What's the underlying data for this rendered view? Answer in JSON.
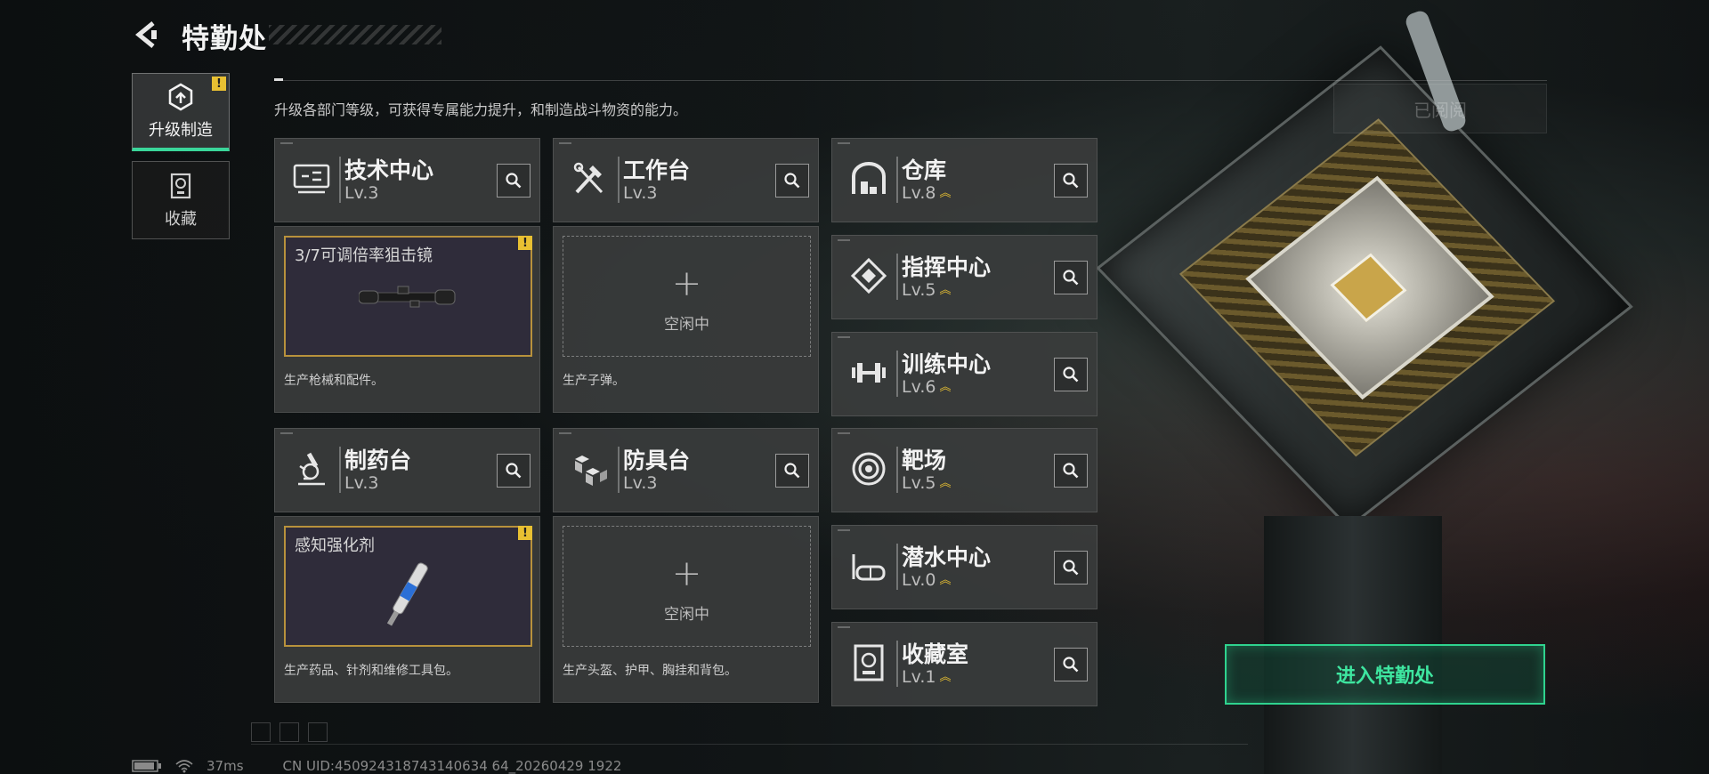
{
  "header": {
    "title": "特勤处",
    "subtitle": "升级各部门等级，可获得专属能力提升，和制造战斗物资的能力。",
    "read_label": "已阅阅"
  },
  "sidebar": {
    "tabs": [
      {
        "label": "升级制造",
        "icon": "upgrade-make-icon",
        "active": true,
        "alert": "!"
      },
      {
        "label": "收藏",
        "icon": "collection-icon",
        "active": false
      }
    ]
  },
  "departments": {
    "tech_center": {
      "name": "技术中心",
      "level": "Lv.3",
      "icon": "monitor-icon"
    },
    "workbench": {
      "name": "工作台",
      "level": "Lv.3",
      "icon": "tools-icon"
    },
    "warehouse": {
      "name": "仓库",
      "level": "Lv.8",
      "icon": "warehouse-icon",
      "upgradable": true
    },
    "command_center": {
      "name": "指挥中心",
      "level": "Lv.5",
      "icon": "command-icon",
      "upgradable": true
    },
    "training_center": {
      "name": "训练中心",
      "level": "Lv.6",
      "icon": "dumbbell-icon",
      "upgradable": true
    },
    "pharmacy": {
      "name": "制药台",
      "level": "Lv.3",
      "icon": "microscope-icon"
    },
    "armor_bench": {
      "name": "防具台",
      "level": "Lv.3",
      "icon": "armor-blocks-icon"
    },
    "shooting_range": {
      "name": "靶场",
      "level": "Lv.5",
      "icon": "target-icon",
      "upgradable": true
    },
    "diving_center": {
      "name": "潜水中心",
      "level": "Lv.0",
      "icon": "diving-mask-icon",
      "upgradable": true
    },
    "collection_room": {
      "name": "收藏室",
      "level": "Lv.1",
      "icon": "collection-room-icon",
      "upgradable": true
    }
  },
  "production": {
    "tech_center": {
      "status": "3/7可调倍率狙击镜",
      "description": "生产枪械和配件。",
      "alert": "!"
    },
    "workbench": {
      "status": "空闲中",
      "plus": "+",
      "description": "生产子弹。"
    },
    "pharmacy": {
      "status": "感知强化剂",
      "description": "生产药品、针剂和维修工具包。",
      "alert": "!"
    },
    "armor_bench": {
      "status": "空闲中",
      "plus": "+",
      "description": "生产头盔、护甲、胸挂和背包。"
    }
  },
  "enter_button": {
    "label": "进入特勤处"
  },
  "footer": {
    "ping": "37ms",
    "uid": "CN UID:450924318743140634 64_20260429 1922"
  },
  "colors": {
    "accent_green": "#2fd38e",
    "warning_yellow": "#e8c032",
    "slot_border_gold": "#b8923c"
  }
}
